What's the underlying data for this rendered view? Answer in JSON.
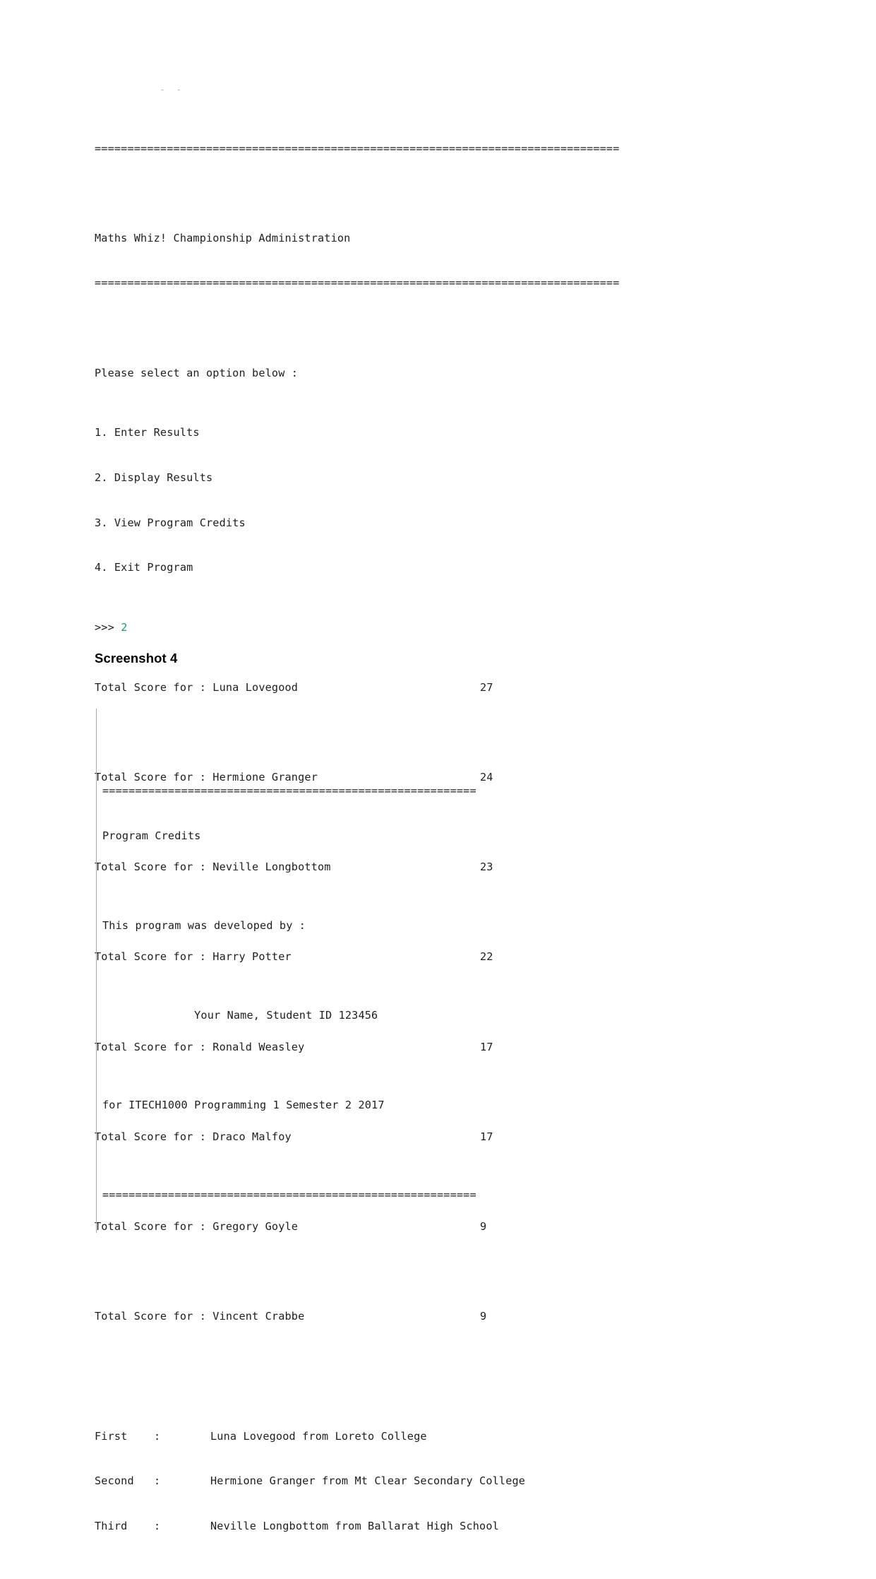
{
  "document": {
    "heading_screenshot4": "Screenshot 4",
    "ghost_artifact": "-  -"
  },
  "colors": {
    "text": "#20201e",
    "prompt_value": "#17a06e",
    "heading": "#000000",
    "textbox_border": "#a9a9a9",
    "page_background": "#ffffff"
  },
  "results_console": {
    "separator_top": "================================================================================",
    "title": "Maths Whiz! Championship Administration",
    "separator_under_title": "================================================================================",
    "menu_prompt": "Please select an option below :",
    "menu_items": [
      "1. Enter Results",
      "2. Display Results",
      "3. View Program Credits",
      "4. Exit Program"
    ],
    "prompt_symbol": ">>> ",
    "prompt_value": "2",
    "score_label_prefix": "Total Score for : ",
    "scores": [
      {
        "name": "Luna Lovegood",
        "value": "27"
      },
      {
        "name": "Hermione Granger",
        "value": "24"
      },
      {
        "name": "Neville Longbottom",
        "value": "23"
      },
      {
        "name": "Harry Potter",
        "value": "22"
      },
      {
        "name": "Ronald Weasley",
        "value": "17"
      },
      {
        "name": "Draco Malfoy",
        "value": "17"
      },
      {
        "name": "Gregory Goyle",
        "value": "9"
      },
      {
        "name": "Vincent Crabbe",
        "value": "9"
      }
    ],
    "podium": [
      {
        "rank": "First",
        "colon": ":",
        "description": "Luna Lovegood from Loreto College"
      },
      {
        "rank": "Second",
        "colon": ":",
        "description": "Hermione Granger from Mt Clear Secondary College"
      },
      {
        "rank": "Third",
        "colon": ":",
        "description": "Neville Longbottom from Ballarat High School"
      }
    ]
  },
  "credits_console": {
    "separator_top": "=========================================================",
    "title": "Program Credits",
    "developed_by_line": "This program was developed by :",
    "author_line": "              Your Name, Student ID 123456",
    "course_line": "for ITECH1000 Programming 1 Semester 2 2017",
    "separator_bottom": "========================================================="
  }
}
